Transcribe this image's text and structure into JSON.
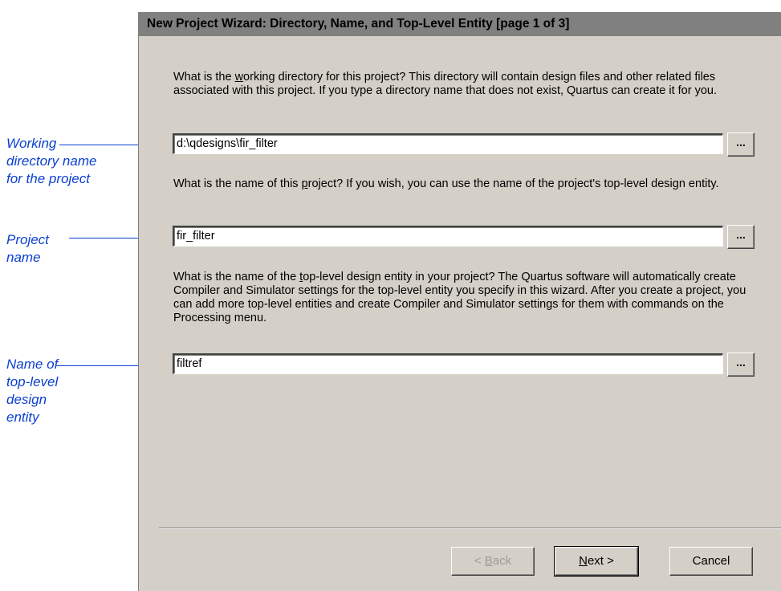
{
  "annotations": {
    "working_directory": [
      "Working",
      "directory name",
      "for the project"
    ],
    "project_name": [
      "Project",
      "name"
    ],
    "top_level_entity": [
      "Name of",
      "top-level",
      "design",
      "entity"
    ]
  },
  "dialog": {
    "title": "New Project Wizard: Directory, Name, and Top-Level Entity [page 1 of 3]",
    "question_directory": {
      "before": "What is the ",
      "mnemonic": "w",
      "after": "orking directory for this project?  This directory will contain design files and other related files associated with this project.  If you type a directory name that does not exist, Quartus can create it for you."
    },
    "directory_value": "d:\\qdesigns\\fir_filter",
    "question_project": {
      "before": "What is the name of this ",
      "mnemonic": "p",
      "after": "roject?  If you wish, you can use the name of the project's top-level design entity."
    },
    "project_value": "fir_filter",
    "question_entity": {
      "before": "What is the name of the ",
      "mnemonic": "t",
      "after": "op-level design entity in your project?  The Quartus software will automatically create Compiler and Simulator settings for the top-level entity you specify in this wizard.  After you create a project, you can add more top-level entities and create Compiler and Simulator settings for them with commands on the Processing menu."
    },
    "entity_value": "filtref",
    "browse_label": "...",
    "buttons": {
      "back": {
        "prefix": "< ",
        "mnemonic": "B",
        "rest": "ack"
      },
      "next": {
        "prefix": "",
        "mnemonic": "N",
        "rest": "ext >"
      },
      "cancel": "Cancel"
    }
  }
}
